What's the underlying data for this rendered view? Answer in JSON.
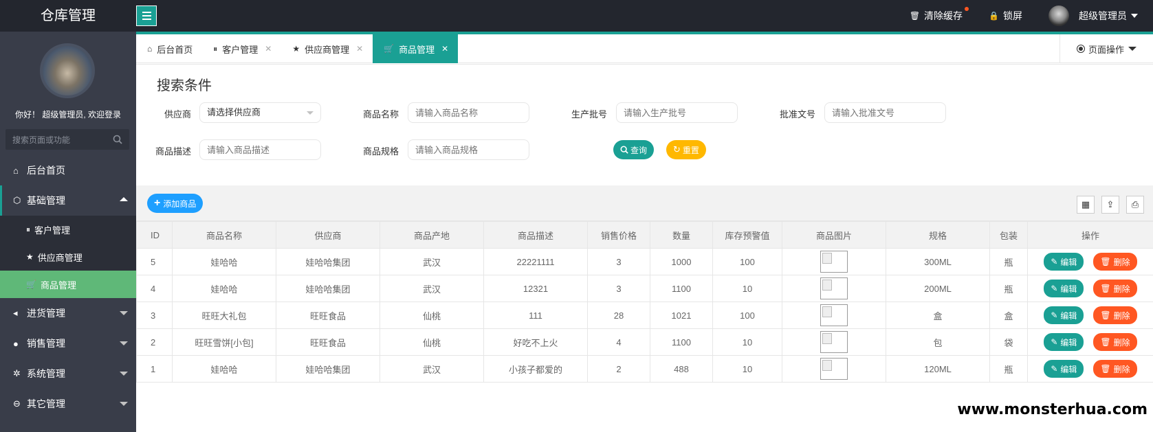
{
  "header": {
    "brand": "仓库管理",
    "clear_cache": "清除缓存",
    "lock_screen": "锁屏",
    "user_name": "超级管理员"
  },
  "sidebar": {
    "welcome": "你好！ 超级管理员, 欢迎登录",
    "search_placeholder": "搜索页面或功能",
    "items": [
      {
        "label": "后台首页",
        "icon": "home-icon"
      },
      {
        "label": "基础管理",
        "icon": "cube-icon"
      },
      {
        "label": "进货管理",
        "icon": "speaker-icon"
      },
      {
        "label": "销售管理",
        "icon": "chat-icon"
      },
      {
        "label": "系统管理",
        "icon": "gear-icon"
      },
      {
        "label": "其它管理",
        "icon": "circle-arrow-icon"
      }
    ],
    "sub_items": [
      {
        "label": "客户管理",
        "icon": "pause-circle-icon"
      },
      {
        "label": "供应商管理",
        "icon": "star-icon"
      },
      {
        "label": "商品管理",
        "icon": "cart-icon"
      }
    ]
  },
  "tabs": [
    {
      "label": "后台首页",
      "icon": "home-icon"
    },
    {
      "label": "客户管理",
      "icon": "pause-circle-icon"
    },
    {
      "label": "供应商管理",
      "icon": "star-icon"
    },
    {
      "label": "商品管理",
      "icon": "cart-icon"
    }
  ],
  "page_ops": "页面操作",
  "search": {
    "legend": "搜索条件",
    "supplier_label": "供应商",
    "supplier_value": "请选择供应商",
    "name_label": "商品名称",
    "name_placeholder": "请输入商品名称",
    "batch_label": "生产批号",
    "batch_placeholder": "请输入生产批号",
    "approval_label": "批准文号",
    "approval_placeholder": "请输入批准文号",
    "desc_label": "商品描述",
    "desc_placeholder": "请输入商品描述",
    "spec_label": "商品规格",
    "spec_placeholder": "请输入商品规格",
    "query_button": "查询",
    "reset_button": "重置"
  },
  "toolbar": {
    "add_button": "添加商品"
  },
  "table": {
    "columns": [
      "ID",
      "商品名称",
      "供应商",
      "商品产地",
      "商品描述",
      "销售价格",
      "数量",
      "库存预警值",
      "商品图片",
      "规格",
      "包装",
      "操作"
    ],
    "edit_label": "编辑",
    "delete_label": "删除",
    "rows": [
      {
        "id": "5",
        "name": "娃哈哈",
        "supplier": "娃哈哈集团",
        "origin": "武汉",
        "desc": "22221111",
        "price": "3",
        "qty": "1000",
        "warn": "100",
        "spec": "300ML",
        "pack": "瓶"
      },
      {
        "id": "4",
        "name": "娃哈哈",
        "supplier": "娃哈哈集团",
        "origin": "武汉",
        "desc": "12321",
        "price": "3",
        "qty": "1100",
        "warn": "10",
        "spec": "200ML",
        "pack": "瓶"
      },
      {
        "id": "3",
        "name": "旺旺大礼包",
        "supplier": "旺旺食品",
        "origin": "仙桃",
        "desc": "111",
        "price": "28",
        "qty": "1021",
        "warn": "100",
        "spec": "盒",
        "pack": "盒"
      },
      {
        "id": "2",
        "name": "旺旺雪饼[小包]",
        "supplier": "旺旺食品",
        "origin": "仙桃",
        "desc": "好吃不上火",
        "price": "4",
        "qty": "1100",
        "warn": "10",
        "spec": "包",
        "pack": "袋"
      },
      {
        "id": "1",
        "name": "娃哈哈",
        "supplier": "娃哈哈集团",
        "origin": "武汉",
        "desc": "小孩子都爱的",
        "price": "2",
        "qty": "488",
        "warn": "10",
        "spec": "120ML",
        "pack": "瓶"
      }
    ]
  },
  "watermark": "www.monsterhua.com",
  "colors": {
    "accent": "#1aa094",
    "danger": "#ff5722",
    "warning": "#ffb800",
    "primary": "#1e9fff",
    "sidebar": "#393d49",
    "active_menu": "#5fb878"
  }
}
